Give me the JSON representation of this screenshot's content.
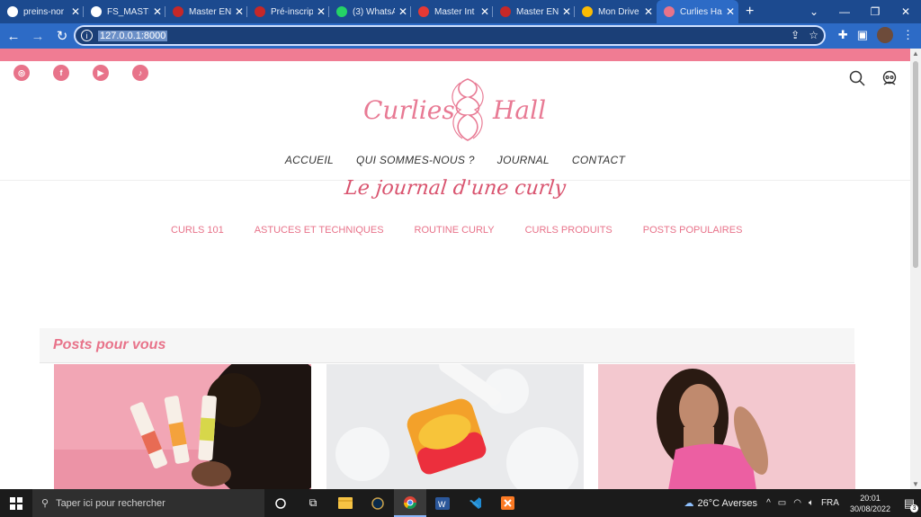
{
  "browser": {
    "tabs": [
      {
        "title": "preins-nor",
        "color": "#ffffff"
      },
      {
        "title": "FS_MASTE",
        "color": "#ffffff"
      },
      {
        "title": "Master EN",
        "color": "#c62828"
      },
      {
        "title": "Pré-inscrip",
        "color": "#c62828"
      },
      {
        "title": "(3) WhatsA",
        "color": "#25d366"
      },
      {
        "title": "Master Int",
        "color": "#e53935"
      },
      {
        "title": "Master EN",
        "color": "#c62828"
      },
      {
        "title": "Mon Drive",
        "color": "#fbbc04"
      },
      {
        "title": "Curlies Ha",
        "color": "#e8738a"
      }
    ],
    "url": "127.0.0.1:8000"
  },
  "site": {
    "logo_left": "Curlies",
    "logo_right": "Hall",
    "nav": [
      "ACCUEIL",
      "QUI SOMMES-NOUS ?",
      "JOURNAL",
      "CONTACT"
    ],
    "journal_title": "Le journal d'une curly",
    "categories": [
      "CURLS 101",
      "ASTUCES ET TECHNIQUES",
      "ROUTINE CURLY",
      "CURLS PRODUITS",
      "POSTS POPULAIRES"
    ],
    "posts_heading": "Posts pour vous",
    "social": [
      "instagram-icon",
      "facebook-icon",
      "youtube-icon",
      "tiktok-icon"
    ],
    "accent": "#e8738a"
  },
  "taskbar": {
    "search_placeholder": "Taper ici pour rechercher",
    "weather": "26°C  Averses",
    "lang": "FRA",
    "time": "20:01",
    "date": "30/08/2022",
    "notif_count": "3"
  }
}
